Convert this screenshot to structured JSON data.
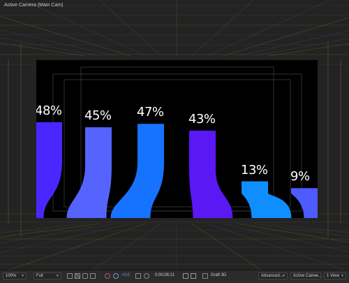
{
  "viewer": {
    "camera_label": "Active Camera (Main Cam)"
  },
  "chart_data": {
    "type": "bar",
    "categories": [
      "",
      "",
      "",
      "",
      "",
      ""
    ],
    "values": [
      48,
      45,
      47,
      43,
      13,
      9
    ],
    "labels": [
      "48%",
      "45%",
      "47%",
      "43%",
      "13%",
      "9%"
    ],
    "colors": [
      "#4b27ff",
      "#5563ff",
      "#1673ff",
      "#5a18f5",
      "#0f8fff",
      "#4d5bff"
    ],
    "ylim": [
      0,
      50
    ]
  },
  "toolbar": {
    "zoom": "100%",
    "resolution": "Full",
    "plus_value": "+0,0",
    "timecode": "0;00;08;21",
    "renderer": "Draft 3D",
    "renderer_options": "Advanced...",
    "camera": "Active Came...",
    "views": "1 View",
    "icons": [
      "region-icon",
      "transparency-icon",
      "mask-icon",
      "safe-icon",
      "color-icon",
      "snapshot-icon",
      "channel-icon"
    ]
  }
}
